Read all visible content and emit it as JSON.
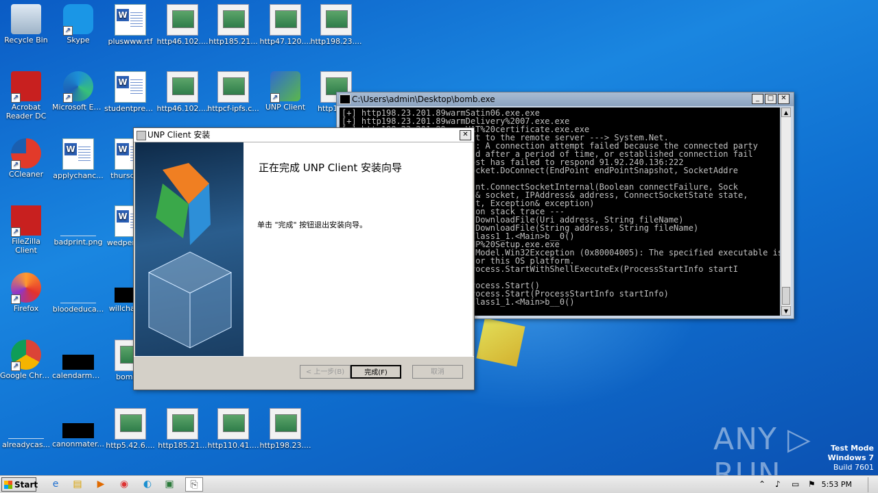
{
  "desktop": {
    "icons": [
      {
        "label": "Recycle Bin",
        "type": "bin"
      },
      {
        "label": "Skype",
        "type": "skype"
      },
      {
        "label": "pluswww.rtf",
        "type": "doc"
      },
      {
        "label": "http46.102....",
        "type": "shot"
      },
      {
        "label": "http185.21...",
        "type": "shot"
      },
      {
        "label": "http47.120....",
        "type": "shot"
      },
      {
        "label": "http198.23....",
        "type": "shot"
      },
      {
        "label": "Acrobat Reader DC",
        "type": "acrobat"
      },
      {
        "label": "Microsoft Edge",
        "type": "edge"
      },
      {
        "label": "studentpres...",
        "type": "doc"
      },
      {
        "label": "http46.102....",
        "type": "shot"
      },
      {
        "label": "httpcf-ipfs.c...",
        "type": "shot"
      },
      {
        "label": "UNP Client",
        "type": "unp"
      },
      {
        "label": "http198...",
        "type": "shot"
      },
      {
        "label": "CCleaner",
        "type": "ccleaner"
      },
      {
        "label": "applychanc...",
        "type": "doc"
      },
      {
        "label": "thursday...",
        "type": "doc"
      },
      {
        "label": "FileZilla Client",
        "type": "filezilla"
      },
      {
        "label": "badprint.png",
        "type": "blank"
      },
      {
        "label": "wedperiod...",
        "type": "doc"
      },
      {
        "label": "Firefox",
        "type": "firefox"
      },
      {
        "label": "bloodeduca...",
        "type": "blank"
      },
      {
        "label": "willchang...",
        "type": "black"
      },
      {
        "label": "Google Chrome",
        "type": "chrome"
      },
      {
        "label": "calendarmet...",
        "type": "black"
      },
      {
        "label": "bomb...",
        "type": "shot"
      },
      {
        "label": "alreadycas...",
        "type": "blank"
      },
      {
        "label": "canonmater...",
        "type": "black"
      },
      {
        "label": "http5.42.6....",
        "type": "shot"
      },
      {
        "label": "http185.21...",
        "type": "shot"
      },
      {
        "label": "http110.41....",
        "type": "shot"
      },
      {
        "label": "http198.23....",
        "type": "shot"
      }
    ]
  },
  "console": {
    "title": "C:\\Users\\admin\\Desktop\\bomb.exe",
    "lines": "[+] http198.23.201.89warmSatin06.exe.exe\n[+] http198.23.201.89warmDelivery%2007.exe.exe\n[+] http198.23.201.89warmVAT%20certificate.exe.exe\n[-] Error: Unable to connect to the remote server ---> System.Net.\n    Sockets.SocketException: A connection attempt failed because the connected party\n    did not properly respond after a period of time, or established connection fail\n    ed because connected host has failed to respond 91.92.240.136:222\n   at System.Net.Sockets.Socket.DoConnect(EndPoint endPointSnapshot, SocketAddre\n\n   at System.Net.ServicePoint.ConnectSocketInternal(Boolean connectFailure, Sock\n   et s4, Socket s6, Socket& socket, IPAddress& address, ConnectSocketState state,\n    IAsyncResult asyncResult, Exception& exception)\n   --- End of inner exception stack trace ---\n   at System.Net.WebClient.DownloadFile(Uri address, String fileName)\n   at System.Net.WebClient.DownloadFile(String address, String fileName)\n   at Program.<>c__DisplayClass1_1.<Main>b__0()\n[+] http198.23.201.89warmUNP%20Setup.exe.exe\n[-] Error: System.ComponentModel.Win32Exception (0x80004005): The specified executable is n\n   ot a valid application for this OS platform.\n   at System.Diagnostics.Process.StartWithShellExecuteEx(ProcessStartInfo startI\n\n   at System.Diagnostics.Process.Start()\n   at System.Diagnostics.Process.Start(ProcessStartInfo startInfo)\n   at Program.<>c__DisplayClass1_1.<Main>b__0()"
  },
  "installer": {
    "title": "UNP Client 安装",
    "heading": "正在完成 UNP Client 安装向导",
    "message": "单击 \"完成\" 按钮退出安装向导。",
    "back_label": "< 上一步(B)",
    "finish_label": "完成(F)",
    "cancel_label": "取消"
  },
  "taskbar": {
    "start_label": "Start",
    "clock": "5:53 PM"
  },
  "watermark": {
    "brand": "ANY ▷ RUN",
    "line1": "Test Mode",
    "line2": "Windows 7",
    "line3": "Build 7601"
  },
  "colors": {
    "desktop_bg": "#1a86e0",
    "console_bg": "#000000",
    "console_text": "#c0c0c0"
  }
}
